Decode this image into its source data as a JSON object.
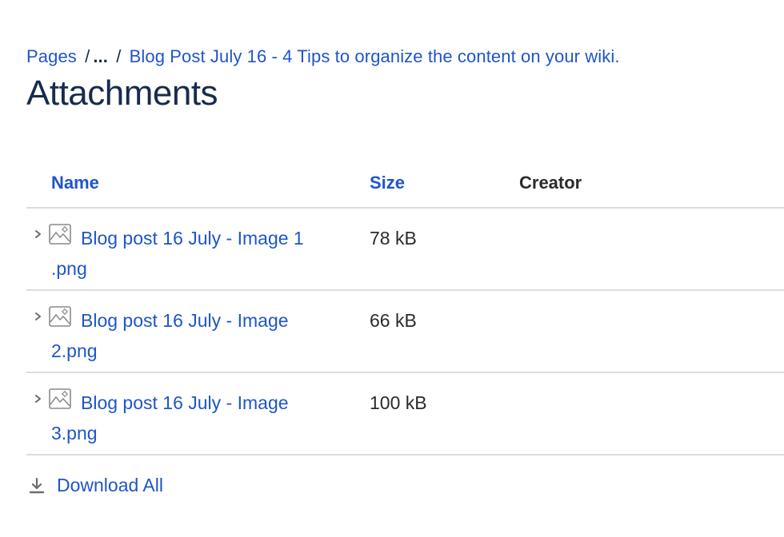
{
  "breadcrumb": {
    "root": "Pages",
    "separator": "/",
    "ellipsis": "...",
    "current": "Blog Post July 16 - 4 Tips to organize the content on your wiki."
  },
  "page_title": "Attachments",
  "table": {
    "columns": {
      "name": "Name",
      "size": "Size",
      "creator": "Creator"
    },
    "rows": [
      {
        "name": "Blog post 16 July - Image 1 .png",
        "size": "78 kB",
        "creator": "",
        "icon": "image-file-icon"
      },
      {
        "name": "Blog post 16 July - Image 2.png",
        "size": "66 kB",
        "creator": "",
        "icon": "image-file-icon"
      },
      {
        "name": "Blog post 16 July - Image 3.png",
        "size": "100 kB",
        "creator": "",
        "icon": "image-file-icon"
      }
    ]
  },
  "download_all": {
    "label": "Download All",
    "icon": "download-icon"
  },
  "colors": {
    "link": "#1f55c9",
    "title": "#172b4d",
    "text": "#2b2b2b",
    "divider": "#dcdcdc"
  }
}
